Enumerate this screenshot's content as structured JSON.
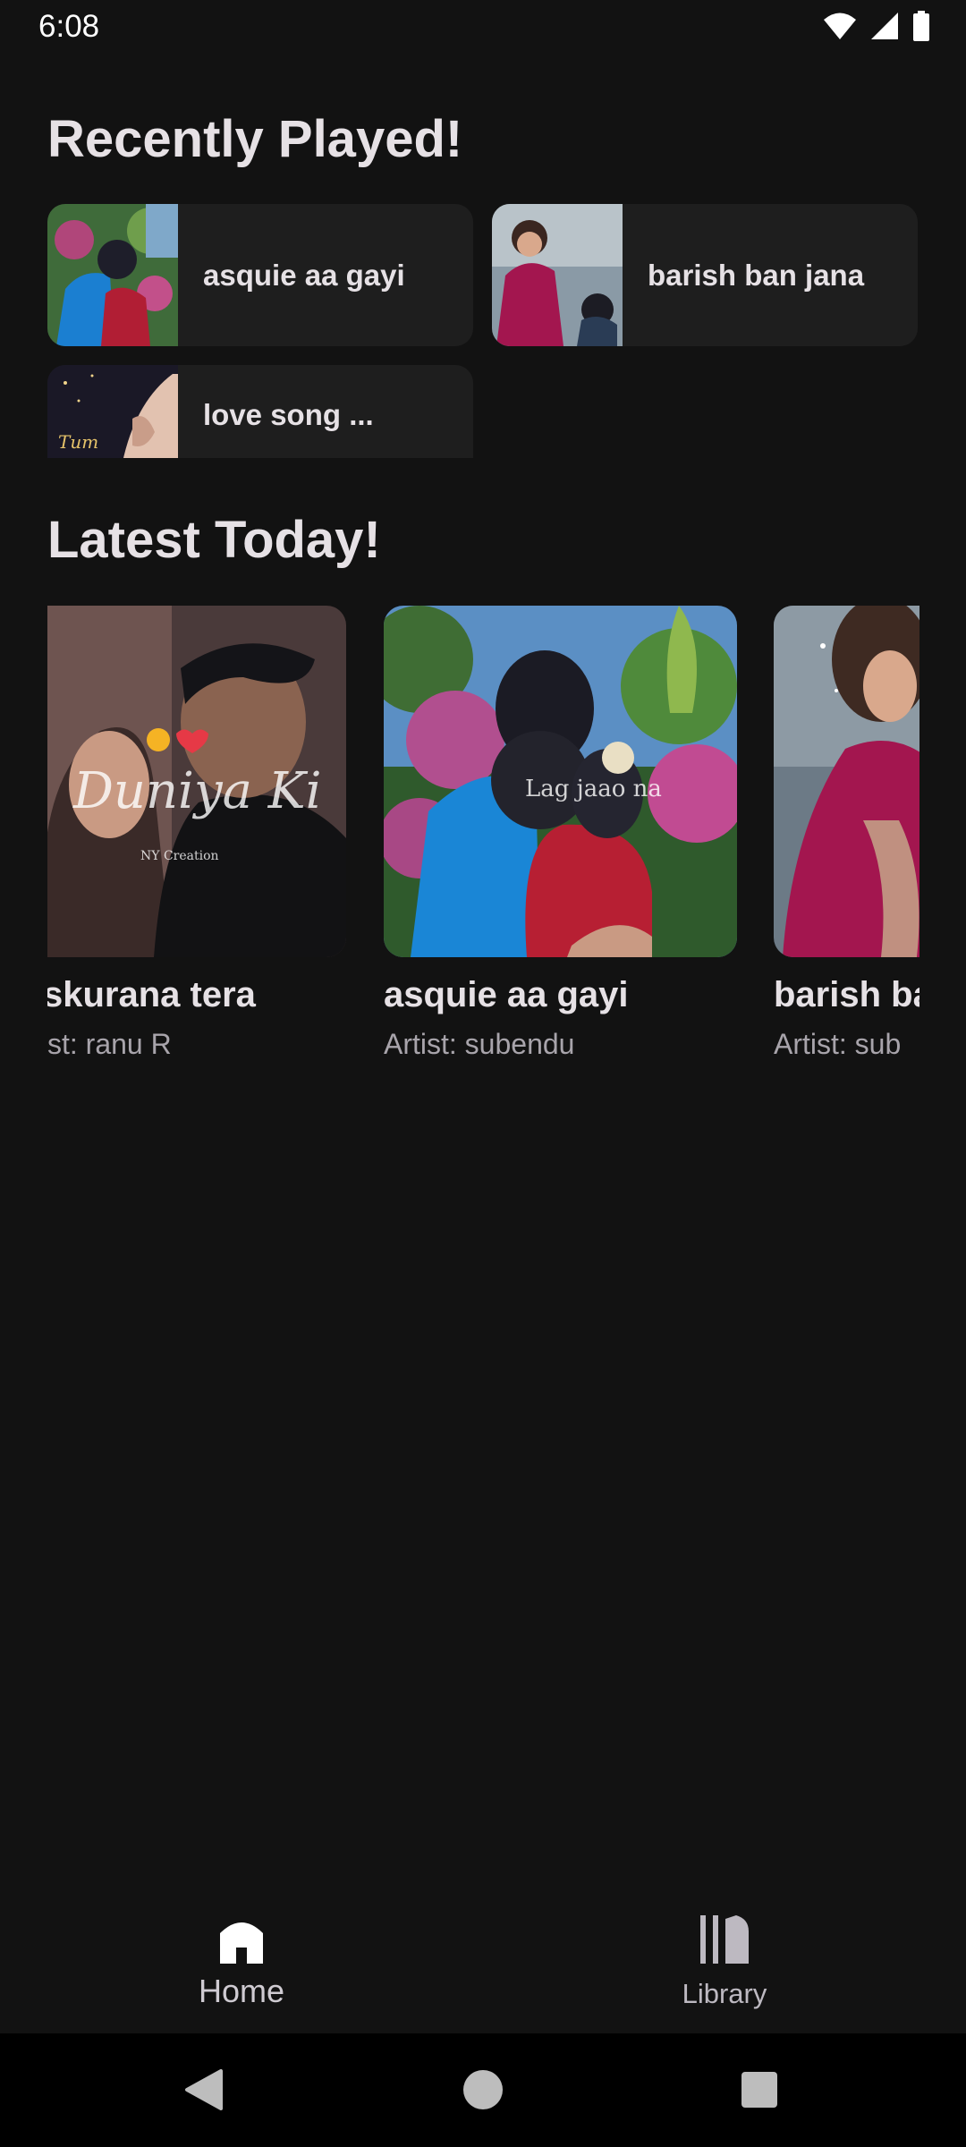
{
  "status": {
    "time": "6:08"
  },
  "recently_played": {
    "title": "Recently Played!",
    "items": [
      {
        "label": "asquie aa gayi"
      },
      {
        "label": "barish ban jana"
      },
      {
        "label": "love song ..."
      }
    ]
  },
  "latest": {
    "title": "Latest Today!",
    "items": [
      {
        "title": "skurana tera",
        "artist": "st: ranu R"
      },
      {
        "title": "asquie aa gayi",
        "artist": "Artist: subendu"
      },
      {
        "title": "barish ba",
        "artist": "Artist: sub"
      }
    ]
  },
  "art_text": {
    "duniya": "Duniya Ki",
    "creator": "NY Creation",
    "lag_jaao": "Lag jaao na",
    "tum": "Tum"
  },
  "nav": {
    "home_label": "Home",
    "library_label": "Library"
  },
  "colors": {
    "background": "#121212",
    "card": "#1e1e1e",
    "text": "#e6e1e5",
    "muted": "#a8a4ab"
  }
}
